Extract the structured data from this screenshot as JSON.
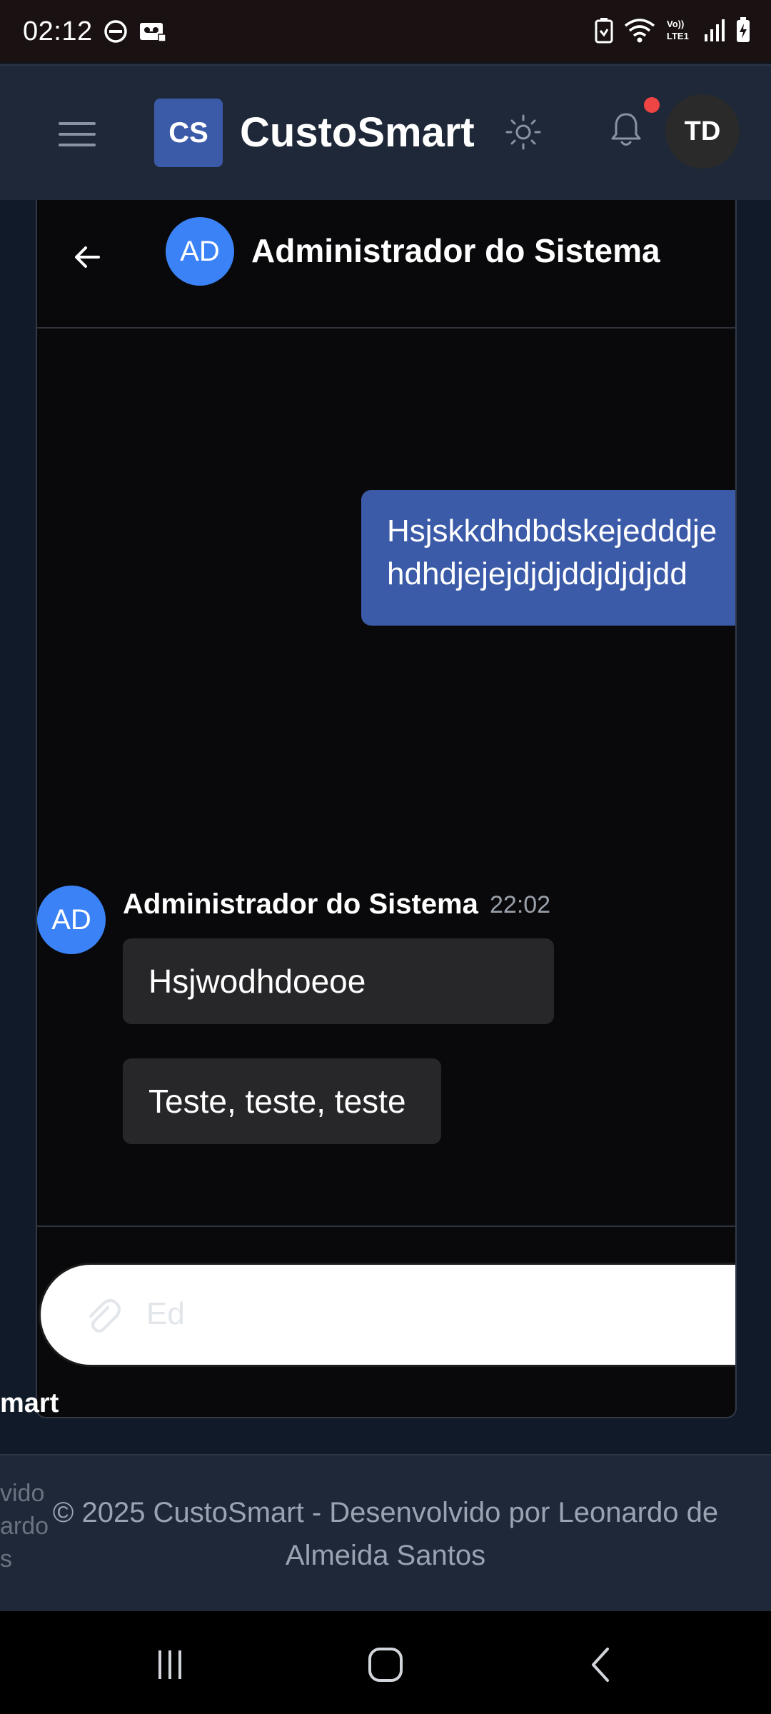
{
  "status_bar": {
    "time": "02:12",
    "icons": [
      "dnd-icon",
      "voicemail-icon",
      "battery-saver-icon",
      "wifi-icon",
      "volte-icon",
      "signal-icon",
      "battery-icon"
    ],
    "volte_label": "Vo)) LTE1"
  },
  "header": {
    "logo_text": "CS",
    "app_name": "CustoSmart",
    "user_initials": "TD",
    "colors": {
      "logo": "#3b5aa8",
      "notification_dot": "#ef4444"
    }
  },
  "chat": {
    "contact_initials": "AD",
    "contact_name": "Administrador do Sistema",
    "sent_message": {
      "line1": "Hsjskkdhdbdskejedddje",
      "line2": "hdhdjejejdjdjddjdjdjdd"
    },
    "received": {
      "sender_initials": "AD",
      "sender": "Administrador do Sistema",
      "time": "22:02",
      "messages": [
        "Hsjwodhdoeoe",
        "Teste, teste, teste"
      ]
    },
    "input_placeholder": "Ed",
    "colors": {
      "sent_bubble": "#3b5aa8",
      "avatar": "#3b82f6",
      "received_bubble": "#27272a"
    }
  },
  "partial_brand": "mart",
  "footer": {
    "side_lines": [
      "vido",
      "ardo",
      "s"
    ],
    "copyright_line1": "© 2025 CustoSmart - Desenvolvido por Leonardo de",
    "copyright_line2": "Almeida Santos"
  },
  "nav_bar": {
    "buttons": [
      "recent-apps-icon",
      "home-icon",
      "back-icon"
    ]
  }
}
